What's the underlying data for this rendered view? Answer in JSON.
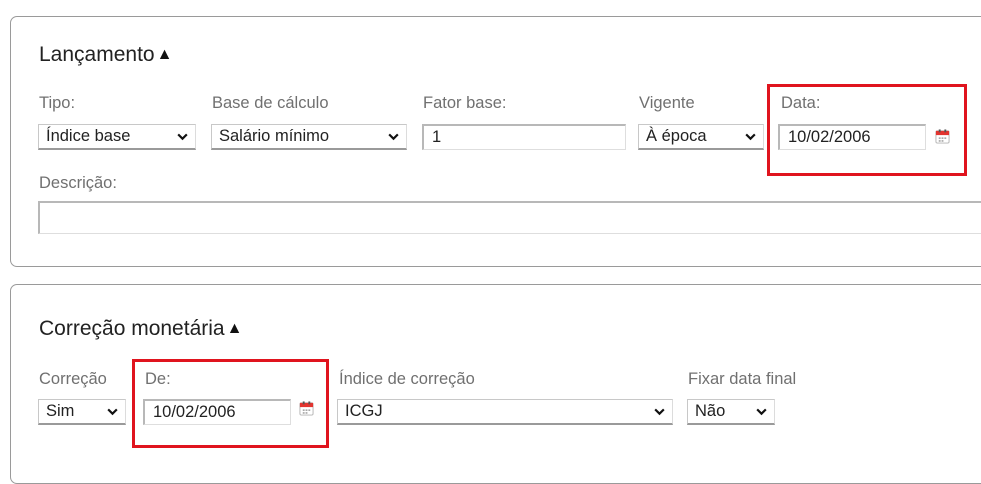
{
  "lancamento": {
    "title": "Lançamento",
    "toggle": "▲",
    "tipo": {
      "label": "Tipo:",
      "value": "Índice base"
    },
    "base_calculo": {
      "label": "Base de cálculo",
      "value": "Salário mínimo"
    },
    "fator_base": {
      "label": "Fator base:",
      "value": "1"
    },
    "vigente": {
      "label": "Vigente",
      "value": "À época"
    },
    "data": {
      "label": "Data:",
      "value": "10/02/2006"
    },
    "descricao": {
      "label": "Descrição:",
      "value": ""
    }
  },
  "correcao": {
    "title": "Correção monetária",
    "toggle": "▲",
    "correcao": {
      "label": "Correção",
      "value": "Sim"
    },
    "de": {
      "label": "De:",
      "value": "10/02/2006"
    },
    "indice": {
      "label": "Índice de correção",
      "value": "ICGJ"
    },
    "fixar": {
      "label": "Fixar data final",
      "value": "Não"
    }
  },
  "highlight_color": "#e0141e",
  "icons": [
    "chevron-down-icon",
    "calendar-icon"
  ]
}
